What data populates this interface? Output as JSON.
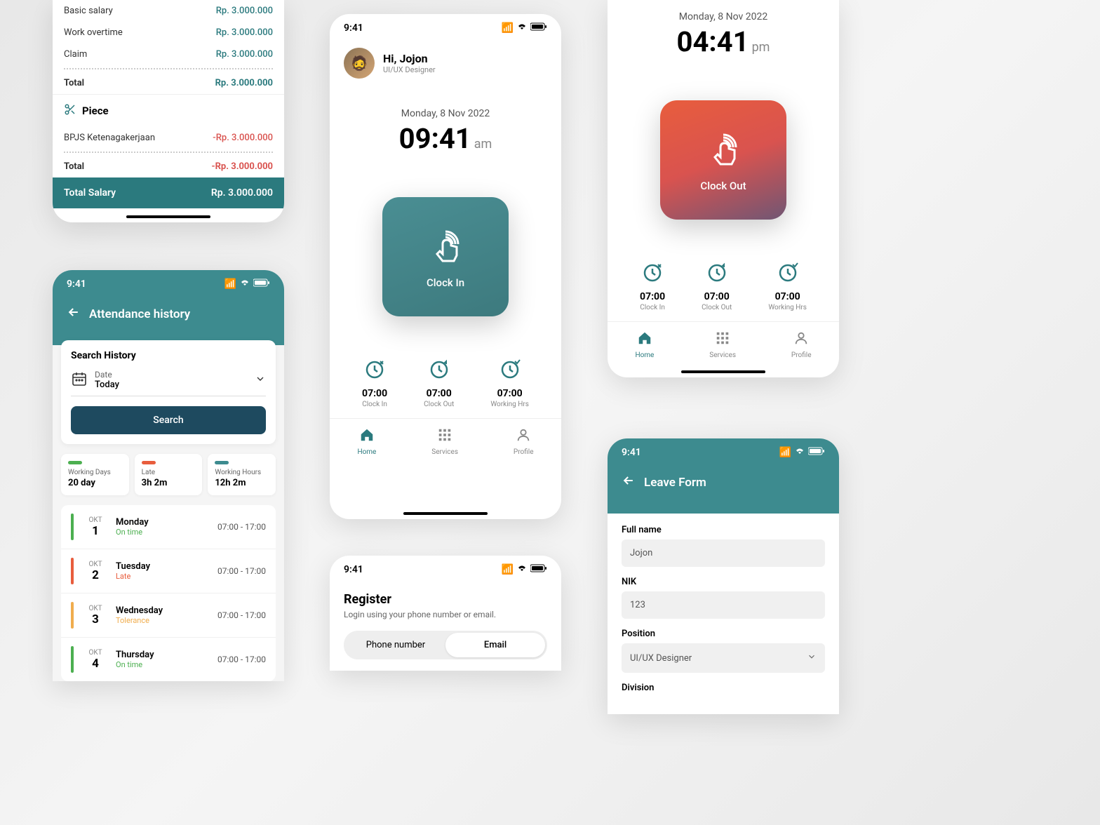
{
  "status": {
    "time": "9:41"
  },
  "salary": {
    "rows": [
      {
        "label": "Basic salary",
        "value": "Rp. 3.000.000"
      },
      {
        "label": "Work overtime",
        "value": "Rp. 3.000.000"
      },
      {
        "label": "Claim",
        "value": "Rp. 3.000.000"
      }
    ],
    "total_label": "Total",
    "total_value": "Rp. 3.000.000",
    "piece_title": "Piece",
    "piece_rows": [
      {
        "label": "BPJS Ketenagakerjaan",
        "value": "-Rp. 3.000.000"
      }
    ],
    "piece_total_label": "Total",
    "piece_total_value": "-Rp. 3.000.000",
    "grand_total_label": "Total Salary",
    "grand_total_value": "Rp. 3.000.000"
  },
  "attendance": {
    "title": "Attendance history",
    "search_title": "Search History",
    "date_label": "Date",
    "date_value": "Today",
    "search_btn": "Search",
    "stats": [
      {
        "label": "Working Days",
        "value": "20 day",
        "color": "#4caf50"
      },
      {
        "label": "Late",
        "value": "3h 2m",
        "color": "#e85d3d"
      },
      {
        "label": "Working Hours",
        "value": "12h 2m",
        "color": "#3d8b8f"
      }
    ],
    "items": [
      {
        "month": "OKT",
        "day": "1",
        "dayname": "Monday",
        "status": "On time",
        "status_color": "#4caf50",
        "time": "07:00 - 17:00",
        "bar": "#4caf50"
      },
      {
        "month": "OKT",
        "day": "2",
        "dayname": "Tuesday",
        "status": "Late",
        "status_color": "#e85d3d",
        "time": "07:00 - 17:00",
        "bar": "#e85d3d"
      },
      {
        "month": "OKT",
        "day": "3",
        "dayname": "Wednesday",
        "status": "Tolerance",
        "status_color": "#f0ad4e",
        "time": "07:00 - 17:00",
        "bar": "#f0ad4e"
      },
      {
        "month": "OKT",
        "day": "4",
        "dayname": "Thursday",
        "status": "On time",
        "status_color": "#4caf50",
        "time": "07:00 - 17:00",
        "bar": "#4caf50"
      }
    ]
  },
  "home": {
    "greeting": "Hi, Jojon",
    "role": "UI/UX Designer",
    "date": "Monday, 8 Nov 2022",
    "time_in": "09:41",
    "time_out": "04:41",
    "ampm_in": "am",
    "ampm_out": "pm",
    "clock_in_label": "Clock In",
    "clock_out_label": "Clock Out",
    "summary": [
      {
        "value": "07:00",
        "label": "Clock In"
      },
      {
        "value": "07:00",
        "label": "Clock Out"
      },
      {
        "value": "07:00",
        "label": "Working Hrs"
      }
    ],
    "nav": {
      "home": "Home",
      "services": "Services",
      "profile": "Profile"
    }
  },
  "register": {
    "title": "Register",
    "subtitle": "Login using your phone number or email.",
    "tab_phone": "Phone number",
    "tab_email": "Email"
  },
  "leave": {
    "title": "Leave Form",
    "fields": {
      "fullname_label": "Full name",
      "fullname_value": "Jojon",
      "nik_label": "NIK",
      "nik_value": "123",
      "position_label": "Position",
      "position_value": "UI/UX Designer",
      "division_label": "Division"
    }
  }
}
